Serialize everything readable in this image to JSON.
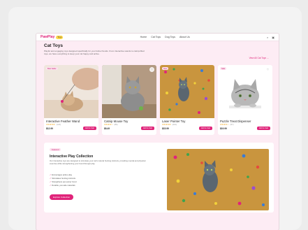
{
  "nav": {
    "logo": "PawPlay",
    "logo_badge": "Toys",
    "links": [
      "Home",
      "Cat Toys",
      "Dog Toys",
      "About Us"
    ],
    "icons": [
      "search-icon",
      "cart-icon"
    ]
  },
  "header": {
    "title": "Cat Toys",
    "description": "Playful and engaging toys designed specifically for your feline friends. From interactive wands to catnip-filled toys, we have everything to keep your cat happy and active.",
    "view_all": "View All Cat Toys →"
  },
  "products": [
    {
      "badge": "Best Seller",
      "name": "Interactive Feather Wand",
      "stars": "★★★★★",
      "reviews": "(124)",
      "price": "$12.99",
      "cart": "Add to Cart",
      "image": "cat-with-feather-wand"
    },
    {
      "badge": "",
      "name": "Catnip Mouse Toy",
      "stars": "★★★★☆",
      "reviews": "(86)",
      "price": "$8.49",
      "cart": "Add to Cart",
      "image": "gray-cat-with-ball"
    },
    {
      "badge": "New",
      "name": "Laser Pointer Toy",
      "stars": "★★★★★",
      "reviews": "(210)",
      "price": "$15.99",
      "cart": "Add to Cart",
      "image": "cat-among-colorful-toys"
    },
    {
      "badge": "Sale",
      "name": "Puzzle Treat Dispenser",
      "stars": "★★★★☆",
      "reviews": "(57)",
      "price": "$19.99",
      "cart": "Add to Cart",
      "image": "cat-peeking-over-edge"
    }
  ],
  "feature": {
    "badge": "Featured",
    "title": "Interactive Play Collection",
    "description": "Our interactive toys are designed to stimulate your cat's natural hunting instincts, providing mental and physical exercise while strengthening your bond through play.",
    "bullets": [
      "Encourages active play",
      "Stimulates hunting instincts",
      "Strengthens pet-owner bond",
      "Durable, pet-safe materials"
    ],
    "button": "Explore Collection"
  },
  "colors": {
    "accent": "#e0247a",
    "page_bg": "#fdecf4"
  }
}
